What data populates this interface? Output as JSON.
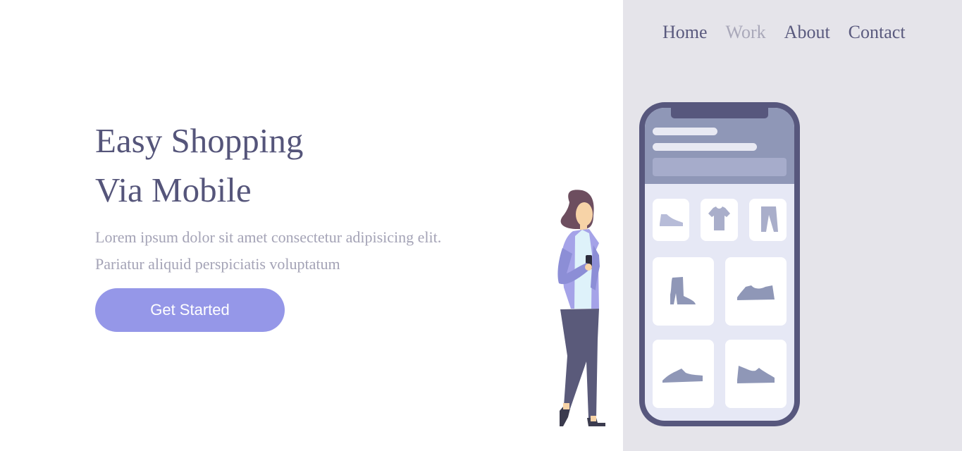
{
  "nav": {
    "items": [
      {
        "label": "Home"
      },
      {
        "label": "Work"
      },
      {
        "label": "About"
      },
      {
        "label": "Contact"
      }
    ]
  },
  "hero": {
    "title_line1": "Easy Shopping",
    "title_line2": "Via Mobile",
    "description": "Lorem ipsum dolor sit amet consectetur adipisicing elit. Pariatur aliquid perspiciatis voluptatum",
    "cta_label": "Get Started"
  },
  "illustration": {
    "product_icons": [
      "shoe-icon",
      "tshirt-icon",
      "pants-icon",
      "boot-icon",
      "sneaker-icon",
      "sneaker-icon",
      "sneaker-icon"
    ]
  },
  "colors": {
    "accent": "#9597e8",
    "text_primary": "#55557a",
    "text_muted": "#a4a3b6",
    "panel_bg": "#e5e4ea",
    "phone_frame": "#57577d"
  }
}
